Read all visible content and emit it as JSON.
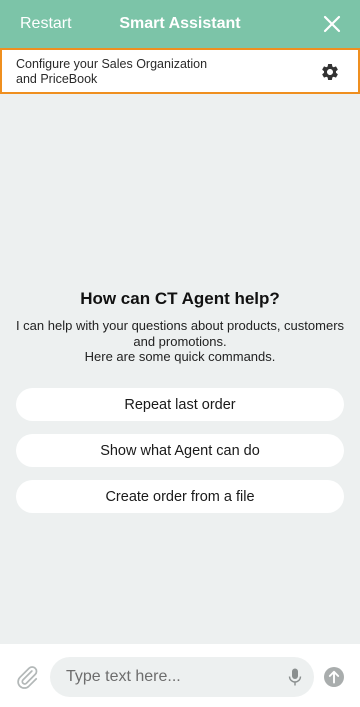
{
  "header": {
    "restart_label": "Restart",
    "title": "Smart Assistant",
    "close_icon": "close-icon",
    "background": "#7cc4a8"
  },
  "config_bar": {
    "line1": "Configure your Sales Organization",
    "line2": "and PriceBook",
    "icon": "gear-icon",
    "border_color": "#ef8f1f"
  },
  "welcome": {
    "title": "How can CT Agent help?",
    "desc_line1": "I can help with your questions about products, customers",
    "desc_line2": "and promotions.",
    "desc_line3": "Here are some quick commands."
  },
  "quick_commands": [
    {
      "label": "Repeat last order"
    },
    {
      "label": "Show what Agent can do"
    },
    {
      "label": "Create order from a file"
    }
  ],
  "composer": {
    "placeholder": "Type text here...",
    "value": "",
    "attach_icon": "paperclip-icon",
    "mic_icon": "microphone-icon",
    "send_icon": "send-arrow-icon"
  }
}
